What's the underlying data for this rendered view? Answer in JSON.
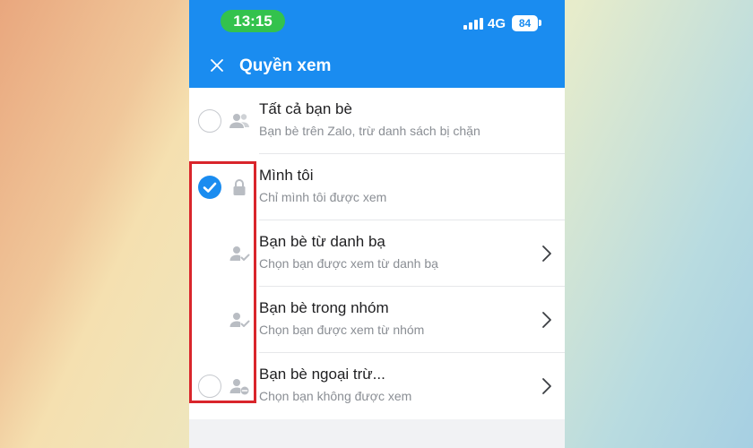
{
  "status_bar": {
    "time": "13:15",
    "network": "4G",
    "battery": "84"
  },
  "header": {
    "close_icon": "close-icon",
    "title": "Quyền xem"
  },
  "options": [
    {
      "title": "Tất cả bạn bè",
      "subtitle": "Bạn bè trên Zalo, trừ danh sách bị chặn",
      "icon": "friends-icon",
      "selected": false,
      "radio": true,
      "chevron": false
    },
    {
      "title": "Mình tôi",
      "subtitle": "Chỉ mình tôi được xem",
      "icon": "lock-icon",
      "selected": true,
      "radio": true,
      "chevron": false
    },
    {
      "title": "Bạn bè từ danh bạ",
      "subtitle": "Chọn bạn được xem từ danh bạ",
      "icon": "user-check-icon",
      "selected": false,
      "radio": false,
      "chevron": true
    },
    {
      "title": "Bạn bè trong nhóm",
      "subtitle": "Chọn bạn được xem từ nhóm",
      "icon": "user-check-icon",
      "selected": false,
      "radio": false,
      "chevron": true
    },
    {
      "title": "Bạn bè ngoại trừ...",
      "subtitle": "Chọn bạn không được xem",
      "icon": "user-minus-icon",
      "selected": false,
      "radio": true,
      "chevron": true
    }
  ],
  "colors": {
    "accent": "#1a8cf0",
    "highlight_box": "#d9252b",
    "time_pill": "#33c24d"
  }
}
